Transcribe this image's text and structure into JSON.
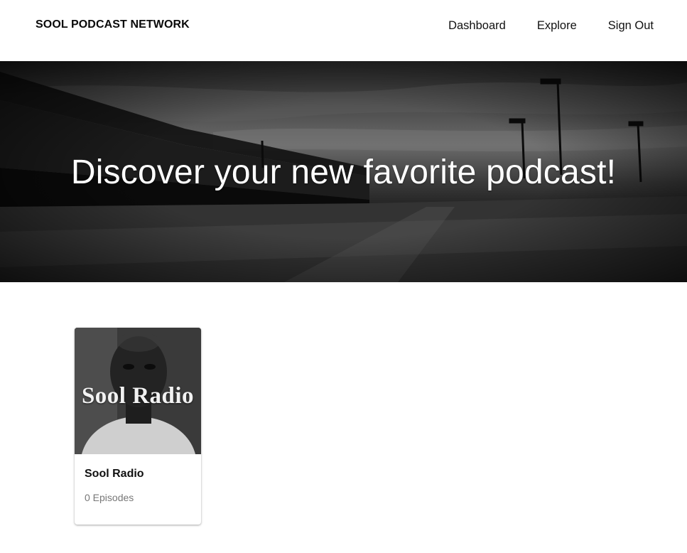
{
  "header": {
    "brand": "SOOL PODCAST NETWORK",
    "nav": [
      {
        "label": "Dashboard"
      },
      {
        "label": "Explore"
      },
      {
        "label": "Sign Out"
      }
    ]
  },
  "hero": {
    "title": "Discover your new favorite podcast!"
  },
  "podcasts": [
    {
      "art_text": "Sool Radio",
      "title": "Sool Radio",
      "episodes": "0 Episodes"
    }
  ],
  "colors": {
    "background": "#ffffff",
    "text": "#111111",
    "muted": "#777777",
    "hero_text": "#ffffff"
  }
}
